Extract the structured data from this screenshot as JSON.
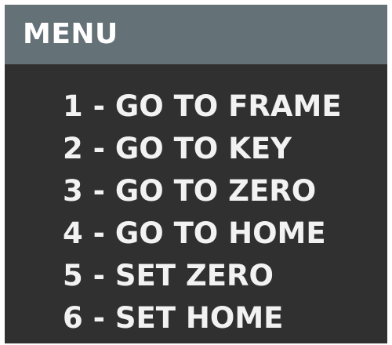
{
  "menu": {
    "title": "MENU",
    "items": [
      {
        "label": "1 - GO TO FRAME"
      },
      {
        "label": "2 - GO TO KEY"
      },
      {
        "label": "3 - GO TO ZERO"
      },
      {
        "label": "4 - GO TO HOME"
      },
      {
        "label": "5 - SET ZERO"
      },
      {
        "label": "6 - SET HOME"
      }
    ]
  },
  "colors": {
    "header_background": "#647177",
    "panel_background": "#303030",
    "text": "#ffffff"
  }
}
